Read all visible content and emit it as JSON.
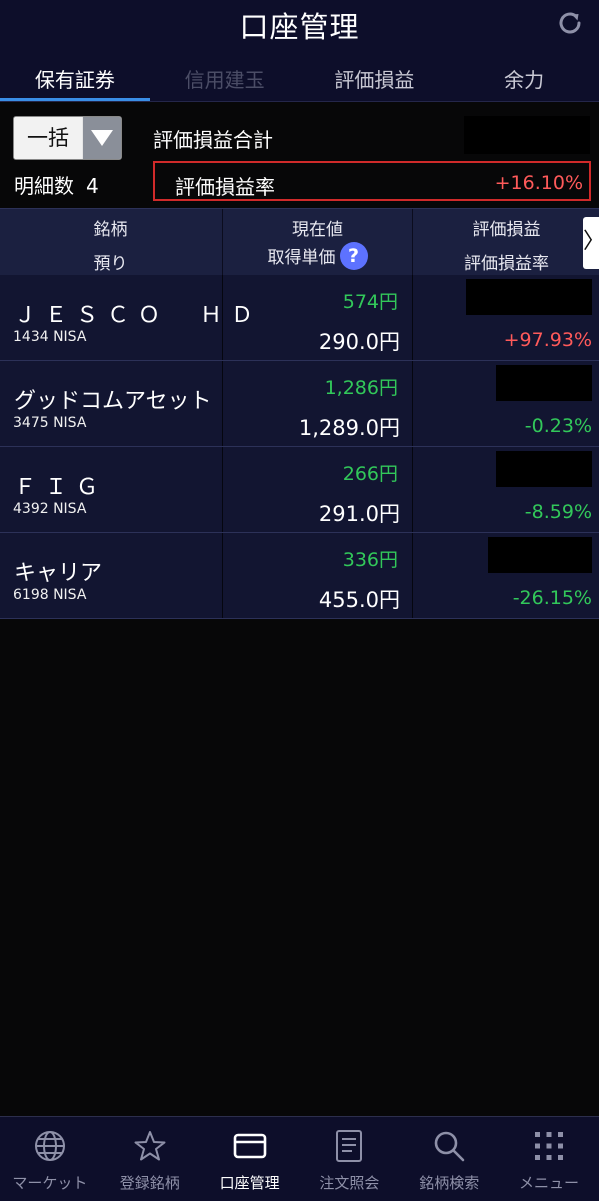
{
  "header": {
    "title": "口座管理"
  },
  "tabs": [
    {
      "label": "保有証券"
    },
    {
      "label": "信用建玉"
    },
    {
      "label": "評価損益"
    },
    {
      "label": "余力"
    }
  ],
  "summary": {
    "select_value": "一括",
    "total_label": "評価損益合計",
    "count_label": "明細数",
    "count_value": "4",
    "rate_label": "評価損益率",
    "rate_value": "+16.10%"
  },
  "table_header": {
    "col1_line1": "銘柄",
    "col1_line2": "預り",
    "col2_line1": "現在値",
    "col2_line2": "取得単価",
    "col2_help": "?",
    "col3_line1": "評価損益",
    "col3_line2": "評価損益率",
    "scroll_arrow": "〉"
  },
  "holdings": [
    {
      "name": "ＪＥＳＣＯ　ＨＤ",
      "code_account": "1434 NISA",
      "price": "574円",
      "cost": "290.0円",
      "rate": "+97.93%"
    },
    {
      "name": "グッドコムアセット",
      "code_account": "3475 NISA",
      "price": "1,286円",
      "cost": "1,289.0円",
      "rate": "-0.23%"
    },
    {
      "name": "ＦＩＧ",
      "code_account": "4392 NISA",
      "price": "266円",
      "cost": "291.0円",
      "rate": "-8.59%"
    },
    {
      "name": "キャリア",
      "code_account": "6198 NISA",
      "price": "336円",
      "cost": "455.0円",
      "rate": "-26.15%"
    }
  ],
  "bottom_nav": [
    {
      "label": "マーケット",
      "icon": "globe-icon"
    },
    {
      "label": "登録銘柄",
      "icon": "star-icon"
    },
    {
      "label": "口座管理",
      "icon": "card-icon"
    },
    {
      "label": "注文照会",
      "icon": "document-icon"
    },
    {
      "label": "銘柄検索",
      "icon": "search-icon"
    },
    {
      "label": "メニュー",
      "icon": "grid-icon"
    }
  ],
  "colors": {
    "positive": "#ff5a5a",
    "negative": "#32c85a",
    "tab_underline": "#3a8ee6",
    "highlight_border": "#d02a2a"
  }
}
